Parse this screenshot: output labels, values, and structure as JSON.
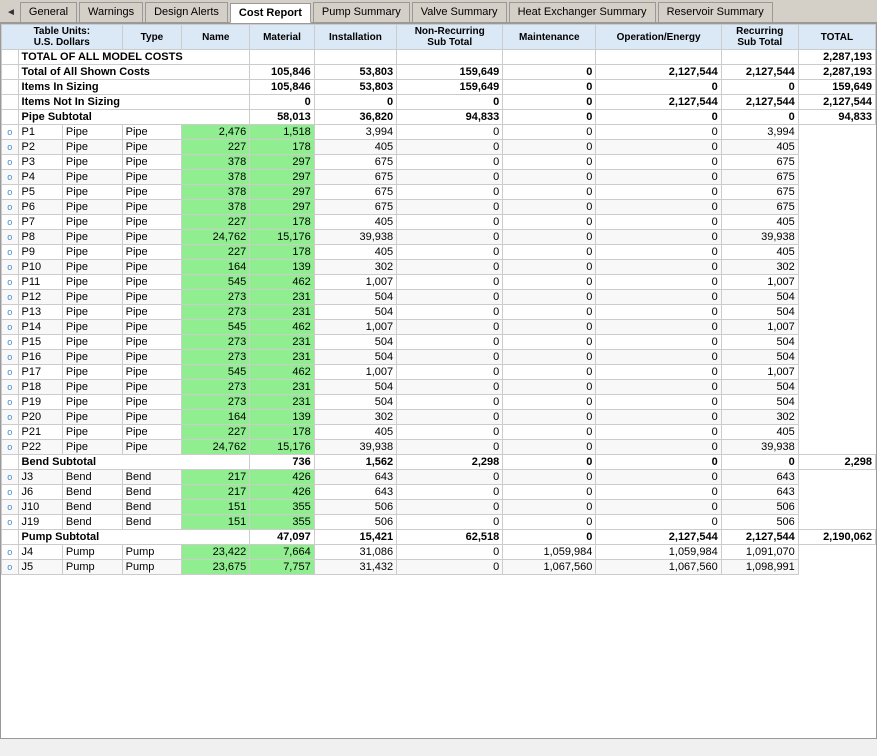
{
  "tabs": [
    {
      "label": "General",
      "active": false
    },
    {
      "label": "Warnings",
      "active": false
    },
    {
      "label": "Design Alerts",
      "active": false
    },
    {
      "label": "Cost Report",
      "active": true
    },
    {
      "label": "Pump Summary",
      "active": false
    },
    {
      "label": "Valve Summary",
      "active": false
    },
    {
      "label": "Heat Exchanger Summary",
      "active": false
    },
    {
      "label": "Reservoir Summary",
      "active": false
    }
  ],
  "table": {
    "units_line1": "Table Units:",
    "units_line2": "U.S. Dollars",
    "columns": [
      "Type",
      "Name",
      "Material",
      "Installation",
      "Non-Recurring\nSub Total",
      "Maintenance",
      "Operation/Energy",
      "Recurring\nSub Total",
      "TOTAL"
    ],
    "summary_rows": [
      {
        "label": "TOTAL OF ALL MODEL COSTS",
        "type": "",
        "name": "",
        "material": "",
        "installation": "",
        "nonrec": "",
        "maintenance": "",
        "openeregy": "",
        "reccring": "",
        "total": "2,287,193",
        "style": "total-all"
      },
      {
        "label": "Total of All Shown Costs",
        "type": "",
        "name": "",
        "material": "105,846",
        "installation": "53,803",
        "nonrec": "159,649",
        "maintenance": "0",
        "openeregy": "2,127,544",
        "reccring": "2,127,544",
        "total": "2,287,193",
        "style": "total-shown"
      },
      {
        "label": "Items In Sizing",
        "type": "",
        "name": "",
        "material": "105,846",
        "installation": "53,803",
        "nonrec": "159,649",
        "maintenance": "0",
        "openeregy": "0",
        "reccring": "0",
        "total": "159,649",
        "style": "items-sizing"
      },
      {
        "label": "Items Not In Sizing",
        "type": "",
        "name": "",
        "material": "0",
        "installation": "0",
        "nonrec": "0",
        "maintenance": "0",
        "openeregy": "2,127,544",
        "reccring": "2,127,544",
        "total": "2,127,544",
        "style": "items-not-sizing"
      }
    ],
    "rows": [
      {
        "id": "pipe-subtotal",
        "label": "Pipe Subtotal",
        "type": "",
        "name": "",
        "material": "58,013",
        "installation": "36,820",
        "nonrec": "94,833",
        "maintenance": "0",
        "openeregy": "0",
        "reccring": "0",
        "total": "94,833",
        "style": "subtotal",
        "mat_green": false,
        "inst_green": false
      },
      {
        "id": "P1",
        "label": "P1",
        "type": "Pipe",
        "name": "Pipe",
        "material": "2,476",
        "installation": "1,518",
        "nonrec": "3,994",
        "maintenance": "0",
        "openeregy": "0",
        "reccring": "0",
        "total": "3,994",
        "mat_green": true,
        "inst_green": true
      },
      {
        "id": "P2",
        "label": "P2",
        "type": "Pipe",
        "name": "Pipe",
        "material": "227",
        "installation": "178",
        "nonrec": "405",
        "maintenance": "0",
        "openeregy": "0",
        "reccring": "0",
        "total": "405",
        "mat_green": true,
        "inst_green": true
      },
      {
        "id": "P3",
        "label": "P3",
        "type": "Pipe",
        "name": "Pipe",
        "material": "378",
        "installation": "297",
        "nonrec": "675",
        "maintenance": "0",
        "openeregy": "0",
        "reccring": "0",
        "total": "675",
        "mat_green": true,
        "inst_green": true
      },
      {
        "id": "P4",
        "label": "P4",
        "type": "Pipe",
        "name": "Pipe",
        "material": "378",
        "installation": "297",
        "nonrec": "675",
        "maintenance": "0",
        "openeregy": "0",
        "reccring": "0",
        "total": "675",
        "mat_green": true,
        "inst_green": true
      },
      {
        "id": "P5",
        "label": "P5",
        "type": "Pipe",
        "name": "Pipe",
        "material": "378",
        "installation": "297",
        "nonrec": "675",
        "maintenance": "0",
        "openeregy": "0",
        "reccring": "0",
        "total": "675",
        "mat_green": true,
        "inst_green": true
      },
      {
        "id": "P6",
        "label": "P6",
        "type": "Pipe",
        "name": "Pipe",
        "material": "378",
        "installation": "297",
        "nonrec": "675",
        "maintenance": "0",
        "openeregy": "0",
        "reccring": "0",
        "total": "675",
        "mat_green": true,
        "inst_green": true
      },
      {
        "id": "P7",
        "label": "P7",
        "type": "Pipe",
        "name": "Pipe",
        "material": "227",
        "installation": "178",
        "nonrec": "405",
        "maintenance": "0",
        "openeregy": "0",
        "reccring": "0",
        "total": "405",
        "mat_green": true,
        "inst_green": true
      },
      {
        "id": "P8",
        "label": "P8",
        "type": "Pipe",
        "name": "Pipe",
        "material": "24,762",
        "installation": "15,176",
        "nonrec": "39,938",
        "maintenance": "0",
        "openeregy": "0",
        "reccring": "0",
        "total": "39,938",
        "mat_green": true,
        "inst_green": true
      },
      {
        "id": "P9",
        "label": "P9",
        "type": "Pipe",
        "name": "Pipe",
        "material": "227",
        "installation": "178",
        "nonrec": "405",
        "maintenance": "0",
        "openeregy": "0",
        "reccring": "0",
        "total": "405",
        "mat_green": true,
        "inst_green": true
      },
      {
        "id": "P10",
        "label": "P10",
        "type": "Pipe",
        "name": "Pipe",
        "material": "164",
        "installation": "139",
        "nonrec": "302",
        "maintenance": "0",
        "openeregy": "0",
        "reccring": "0",
        "total": "302",
        "mat_green": true,
        "inst_green": true
      },
      {
        "id": "P11",
        "label": "P11",
        "type": "Pipe",
        "name": "Pipe",
        "material": "545",
        "installation": "462",
        "nonrec": "1,007",
        "maintenance": "0",
        "openeregy": "0",
        "reccring": "0",
        "total": "1,007",
        "mat_green": true,
        "inst_green": true
      },
      {
        "id": "P12",
        "label": "P12",
        "type": "Pipe",
        "name": "Pipe",
        "material": "273",
        "installation": "231",
        "nonrec": "504",
        "maintenance": "0",
        "openeregy": "0",
        "reccring": "0",
        "total": "504",
        "mat_green": true,
        "inst_green": true
      },
      {
        "id": "P13",
        "label": "P13",
        "type": "Pipe",
        "name": "Pipe",
        "material": "273",
        "installation": "231",
        "nonrec": "504",
        "maintenance": "0",
        "openeregy": "0",
        "reccring": "0",
        "total": "504",
        "mat_green": true,
        "inst_green": true
      },
      {
        "id": "P14",
        "label": "P14",
        "type": "Pipe",
        "name": "Pipe",
        "material": "545",
        "installation": "462",
        "nonrec": "1,007",
        "maintenance": "0",
        "openeregy": "0",
        "reccring": "0",
        "total": "1,007",
        "mat_green": true,
        "inst_green": true
      },
      {
        "id": "P15",
        "label": "P15",
        "type": "Pipe",
        "name": "Pipe",
        "material": "273",
        "installation": "231",
        "nonrec": "504",
        "maintenance": "0",
        "openeregy": "0",
        "reccring": "0",
        "total": "504",
        "mat_green": true,
        "inst_green": true
      },
      {
        "id": "P16",
        "label": "P16",
        "type": "Pipe",
        "name": "Pipe",
        "material": "273",
        "installation": "231",
        "nonrec": "504",
        "maintenance": "0",
        "openeregy": "0",
        "reccring": "0",
        "total": "504",
        "mat_green": true,
        "inst_green": true
      },
      {
        "id": "P17",
        "label": "P17",
        "type": "Pipe",
        "name": "Pipe",
        "material": "545",
        "installation": "462",
        "nonrec": "1,007",
        "maintenance": "0",
        "openeregy": "0",
        "reccring": "0",
        "total": "1,007",
        "mat_green": true,
        "inst_green": true
      },
      {
        "id": "P18",
        "label": "P18",
        "type": "Pipe",
        "name": "Pipe",
        "material": "273",
        "installation": "231",
        "nonrec": "504",
        "maintenance": "0",
        "openeregy": "0",
        "reccring": "0",
        "total": "504",
        "mat_green": true,
        "inst_green": true
      },
      {
        "id": "P19",
        "label": "P19",
        "type": "Pipe",
        "name": "Pipe",
        "material": "273",
        "installation": "231",
        "nonrec": "504",
        "maintenance": "0",
        "openeregy": "0",
        "reccring": "0",
        "total": "504",
        "mat_green": true,
        "inst_green": true
      },
      {
        "id": "P20",
        "label": "P20",
        "type": "Pipe",
        "name": "Pipe",
        "material": "164",
        "installation": "139",
        "nonrec": "302",
        "maintenance": "0",
        "openeregy": "0",
        "reccring": "0",
        "total": "302",
        "mat_green": true,
        "inst_green": true
      },
      {
        "id": "P21",
        "label": "P21",
        "type": "Pipe",
        "name": "Pipe",
        "material": "227",
        "installation": "178",
        "nonrec": "405",
        "maintenance": "0",
        "openeregy": "0",
        "reccring": "0",
        "total": "405",
        "mat_green": true,
        "inst_green": true
      },
      {
        "id": "P22",
        "label": "P22",
        "type": "Pipe",
        "name": "Pipe",
        "material": "24,762",
        "installation": "15,176",
        "nonrec": "39,938",
        "maintenance": "0",
        "openeregy": "0",
        "reccring": "0",
        "total": "39,938",
        "mat_green": true,
        "inst_green": true
      },
      {
        "id": "bend-subtotal",
        "label": "Bend Subtotal",
        "type": "",
        "name": "",
        "material": "736",
        "installation": "1,562",
        "nonrec": "2,298",
        "maintenance": "0",
        "openeregy": "0",
        "reccring": "0",
        "total": "2,298",
        "style": "subtotal",
        "mat_green": false,
        "inst_green": false
      },
      {
        "id": "J3",
        "label": "J3",
        "type": "Bend",
        "name": "Bend",
        "material": "217",
        "installation": "426",
        "nonrec": "643",
        "maintenance": "0",
        "openeregy": "0",
        "reccring": "0",
        "total": "643",
        "mat_green": true,
        "inst_green": true
      },
      {
        "id": "J6",
        "label": "J6",
        "type": "Bend",
        "name": "Bend",
        "material": "217",
        "installation": "426",
        "nonrec": "643",
        "maintenance": "0",
        "openeregy": "0",
        "reccring": "0",
        "total": "643",
        "mat_green": true,
        "inst_green": true
      },
      {
        "id": "J10",
        "label": "J10",
        "type": "Bend",
        "name": "Bend",
        "material": "151",
        "installation": "355",
        "nonrec": "506",
        "maintenance": "0",
        "openeregy": "0",
        "reccring": "0",
        "total": "506",
        "mat_green": true,
        "inst_green": true
      },
      {
        "id": "J19",
        "label": "J19",
        "type": "Bend",
        "name": "Bend",
        "material": "151",
        "installation": "355",
        "nonrec": "506",
        "maintenance": "0",
        "openeregy": "0",
        "reccring": "0",
        "total": "506",
        "mat_green": true,
        "inst_green": true
      },
      {
        "id": "pump-subtotal",
        "label": "Pump Subtotal",
        "type": "",
        "name": "",
        "material": "47,097",
        "installation": "15,421",
        "nonrec": "62,518",
        "maintenance": "0",
        "openeregy": "2,127,544",
        "reccring": "2,127,544",
        "total": "2,190,062",
        "style": "subtotal",
        "mat_green": false,
        "inst_green": false
      },
      {
        "id": "J4",
        "label": "J4",
        "type": "Pump",
        "name": "Pump",
        "material": "23,422",
        "installation": "7,664",
        "nonrec": "31,086",
        "maintenance": "0",
        "openeregy": "1,059,984",
        "reccring": "1,059,984",
        "total": "1,091,070",
        "mat_green": true,
        "inst_green": true
      },
      {
        "id": "J5",
        "label": "J5",
        "type": "Pump",
        "name": "Pump",
        "material": "23,675",
        "installation": "7,757",
        "nonrec": "31,432",
        "maintenance": "0",
        "openeregy": "1,067,560",
        "reccring": "1,067,560",
        "total": "1,098,991",
        "mat_green": true,
        "inst_green": true
      }
    ]
  }
}
